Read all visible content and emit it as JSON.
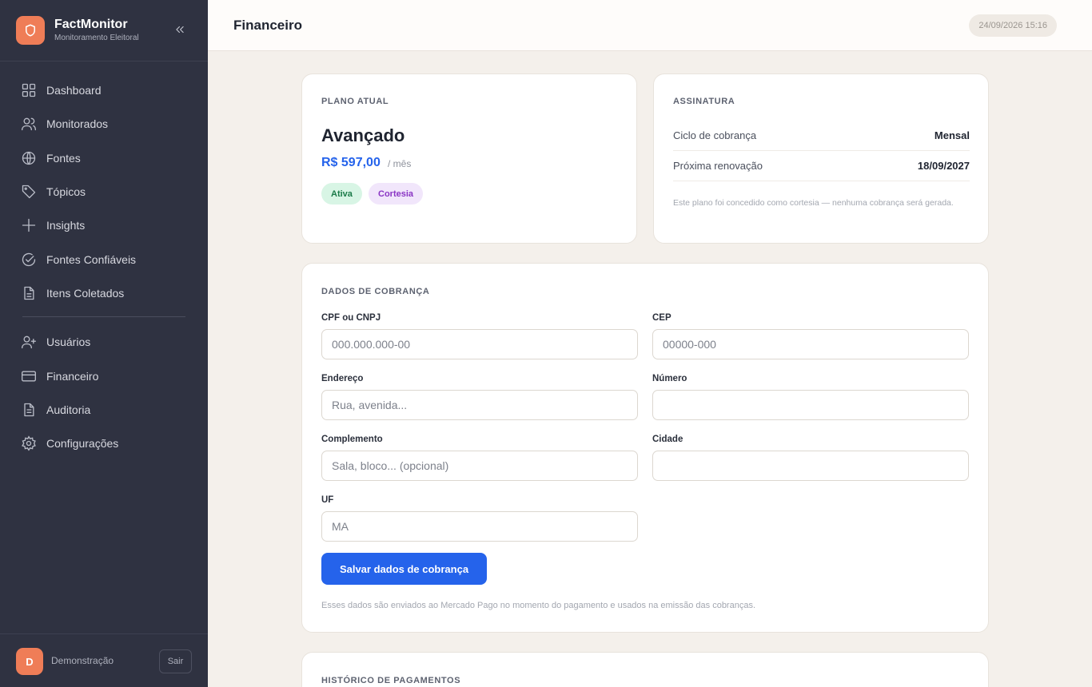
{
  "app": {
    "name": "FactMonitor",
    "subtitle": "Monitoramento Eleitoral",
    "accent": "#ef7d57",
    "primary": "#2563eb"
  },
  "sidebar": {
    "items": [
      {
        "label": "Dashboard",
        "icon": "grid-icon"
      },
      {
        "label": "Monitorados",
        "icon": "users-icon"
      },
      {
        "label": "Fontes",
        "icon": "globe-icon"
      },
      {
        "label": "Tópicos",
        "icon": "tag-icon"
      },
      {
        "label": "Insights",
        "icon": "plus-icon"
      },
      {
        "label": "Fontes Confiáveis",
        "icon": "check-circle-icon"
      },
      {
        "label": "Itens Coletados",
        "icon": "document-icon"
      },
      {
        "label": "Usuários",
        "icon": "user-plus-icon"
      },
      {
        "label": "Financeiro",
        "icon": "credit-card-icon"
      },
      {
        "label": "Auditoria",
        "icon": "file-text-icon"
      },
      {
        "label": "Configurações",
        "icon": "gear-icon"
      }
    ],
    "user": {
      "initial": "D",
      "name": "Demonstração",
      "logout_label": "Sair"
    }
  },
  "header": {
    "title": "Financeiro",
    "datetime": "24/09/2026 15:16"
  },
  "plan": {
    "section_title": "PLANO ATUAL",
    "name": "Avançado",
    "price": "R$ 597,00",
    "period": "/ mês",
    "badges": [
      {
        "label": "Ativa",
        "color": "#1a7a48"
      },
      {
        "label": "Cortesia",
        "color": "#8a35c4"
      }
    ]
  },
  "subscription": {
    "section_title": "ASSINATURA",
    "rows": [
      {
        "key": "Ciclo de cobrança",
        "value": "Mensal"
      },
      {
        "key": "Próxima renovação",
        "value": "18/09/2027"
      }
    ],
    "note": "Este plano foi concedido como cortesia — nenhuma cobrança será gerada."
  },
  "billing": {
    "section_title": "DADOS DE COBRANÇA",
    "fields": {
      "doc": {
        "label": "CPF ou CNPJ",
        "placeholder": "000.000.000-00",
        "value": ""
      },
      "cep": {
        "label": "CEP",
        "placeholder": "00000-000",
        "value": ""
      },
      "address": {
        "label": "Endereço",
        "placeholder": "Rua, avenida...",
        "value": ""
      },
      "number": {
        "label": "Número",
        "placeholder": "",
        "value": ""
      },
      "complement": {
        "label": "Complemento",
        "placeholder": "Sala, bloco... (opcional)",
        "value": ""
      },
      "city": {
        "label": "Cidade",
        "placeholder": "",
        "value": ""
      },
      "uf": {
        "label": "UF",
        "placeholder": "MA",
        "value": ""
      }
    },
    "save_label": "Salvar dados de cobrança",
    "note": "Esses dados são enviados ao Mercado Pago no momento do pagamento e usados na emissão das cobranças."
  },
  "history": {
    "section_title": "HISTÓRICO DE PAGAMENTOS"
  }
}
